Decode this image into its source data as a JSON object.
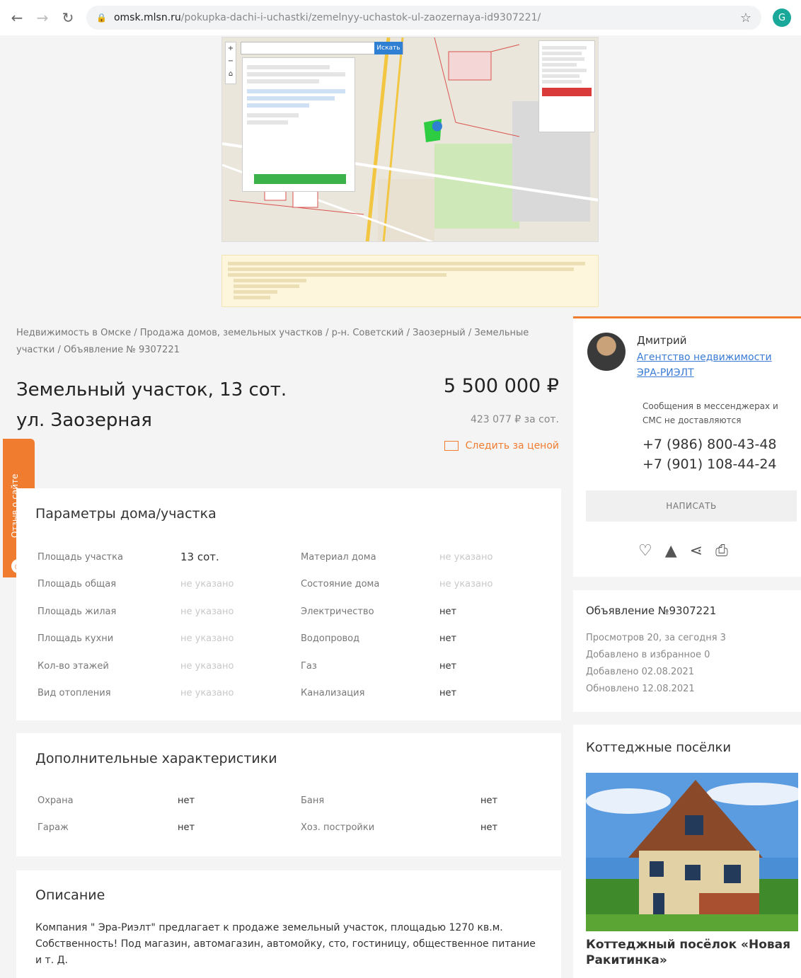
{
  "browser": {
    "url_host": "omsk.mlsn.ru",
    "url_path": "/pokupka-dachi-i-uchastki/zemelnyy-uchastok-ul-zaozernaya-id9307221/",
    "profile_initial": "G"
  },
  "map": {
    "search_placeholder": "",
    "search_button": "Искать"
  },
  "breadcrumb": "Недвижимость в Омске / Продажа домов, земельных участков / р-н. Советский / Заозерный / Земельные участки / Объявление № 9307221",
  "listing": {
    "title_line1": "Земельный участок, 13 сот.",
    "title_line2": "ул. Заозерная",
    "price": "5 500 000 ₽",
    "price_per": "423 077 ₽ за сот.",
    "follow_price": "Следить за ценой"
  },
  "feedback_tab": "Отзыв о сайте",
  "params": {
    "title": "Параметры дома/участка",
    "rows": [
      {
        "l1": "Площадь участка",
        "v1": "13 сот.",
        "v1_muted": false,
        "l2": "Материал дома",
        "v2": "не указано",
        "v2_muted": true
      },
      {
        "l1": "Площадь общая",
        "v1": "не указано",
        "v1_muted": true,
        "l2": "Состояние дома",
        "v2": "не указано",
        "v2_muted": true
      },
      {
        "l1": "Площадь жилая",
        "v1": "не указано",
        "v1_muted": true,
        "l2": "Электричество",
        "v2": "нет",
        "v2_muted": false
      },
      {
        "l1": "Площадь кухни",
        "v1": "не указано",
        "v1_muted": true,
        "l2": "Водопровод",
        "v2": "нет",
        "v2_muted": false
      },
      {
        "l1": "Кол-во этажей",
        "v1": "не указано",
        "v1_muted": true,
        "l2": "Газ",
        "v2": "нет",
        "v2_muted": false
      },
      {
        "l1": "Вид отопления",
        "v1": "не указано",
        "v1_muted": true,
        "l2": "Канализация",
        "v2": "нет",
        "v2_muted": false
      }
    ]
  },
  "extra": {
    "title": "Дополнительные характеристики",
    "rows": [
      {
        "l1": "Охрана",
        "v1": "нет",
        "l2": "Баня",
        "v2": "нет"
      },
      {
        "l1": "Гараж",
        "v1": "нет",
        "l2": "Хоз. постройки",
        "v2": "нет"
      }
    ]
  },
  "description": {
    "title": "Описание",
    "text": "Компания \" Эра-Риэлт\" предлагает к продаже земельный участок, площадью 1270 кв.м. Собственность! Под магазин, автомагазин, автомойку, сто, гостиницу, общественное питание и т. Д."
  },
  "agent": {
    "name": "Дмитрий",
    "agency": "Агентство недвижимости ЭРА-РИЭЛТ",
    "note": "Сообщения в мессенджерах и СМС не доставляются",
    "phone1": "+7 (986) 800-43-48",
    "phone2": "+7 (901) 108-44-24",
    "write_button": "НАПИСАТЬ"
  },
  "ad_info": {
    "title": "Объявление №9307221",
    "views": "Просмотров 20, за сегодня 3",
    "favorites": "Добавлено в избранное 0",
    "added": "Добавлено 02.08.2021",
    "updated": "Обновлено 12.08.2021"
  },
  "cottages": {
    "title": "Коттеджные посёлки",
    "caption": "Коттеджный посёлок «Новая Ракитинка»"
  },
  "colors": {
    "accent": "#f07c30",
    "link": "#3a7bd5"
  }
}
